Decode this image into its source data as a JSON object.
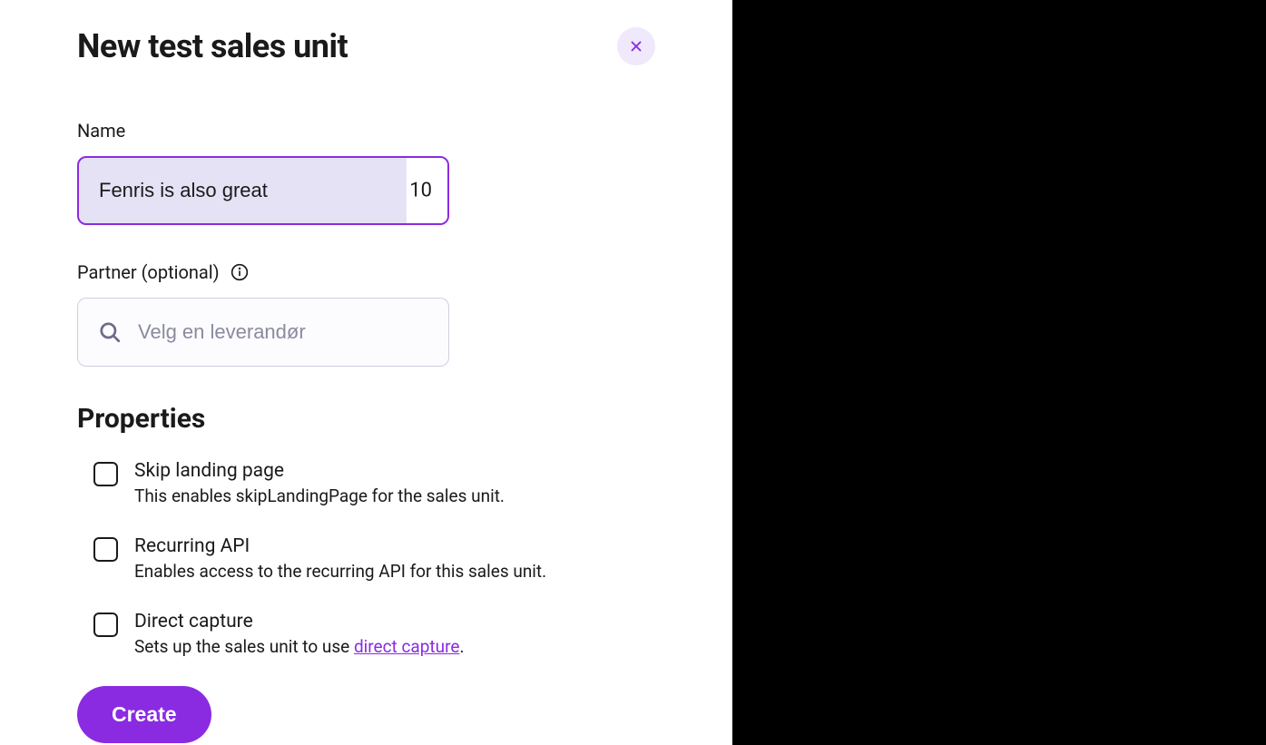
{
  "header": {
    "title": "New test sales unit"
  },
  "form": {
    "name_label": "Name",
    "name_value": "Fenris is also great",
    "name_counter": "10",
    "partner_label": "Partner (optional)",
    "partner_placeholder": "Velg en leverandør"
  },
  "properties": {
    "section_title": "Properties",
    "items": [
      {
        "label": "Skip landing page",
        "description": "This enables skipLandingPage for the sales unit."
      },
      {
        "label": "Recurring API",
        "description": "Enables access to the recurring API for this sales unit."
      },
      {
        "label": "Direct capture",
        "description_prefix": "Sets up the sales unit to use ",
        "description_link_text": "direct capture",
        "description_suffix": "."
      }
    ]
  },
  "actions": {
    "create_label": "Create"
  }
}
